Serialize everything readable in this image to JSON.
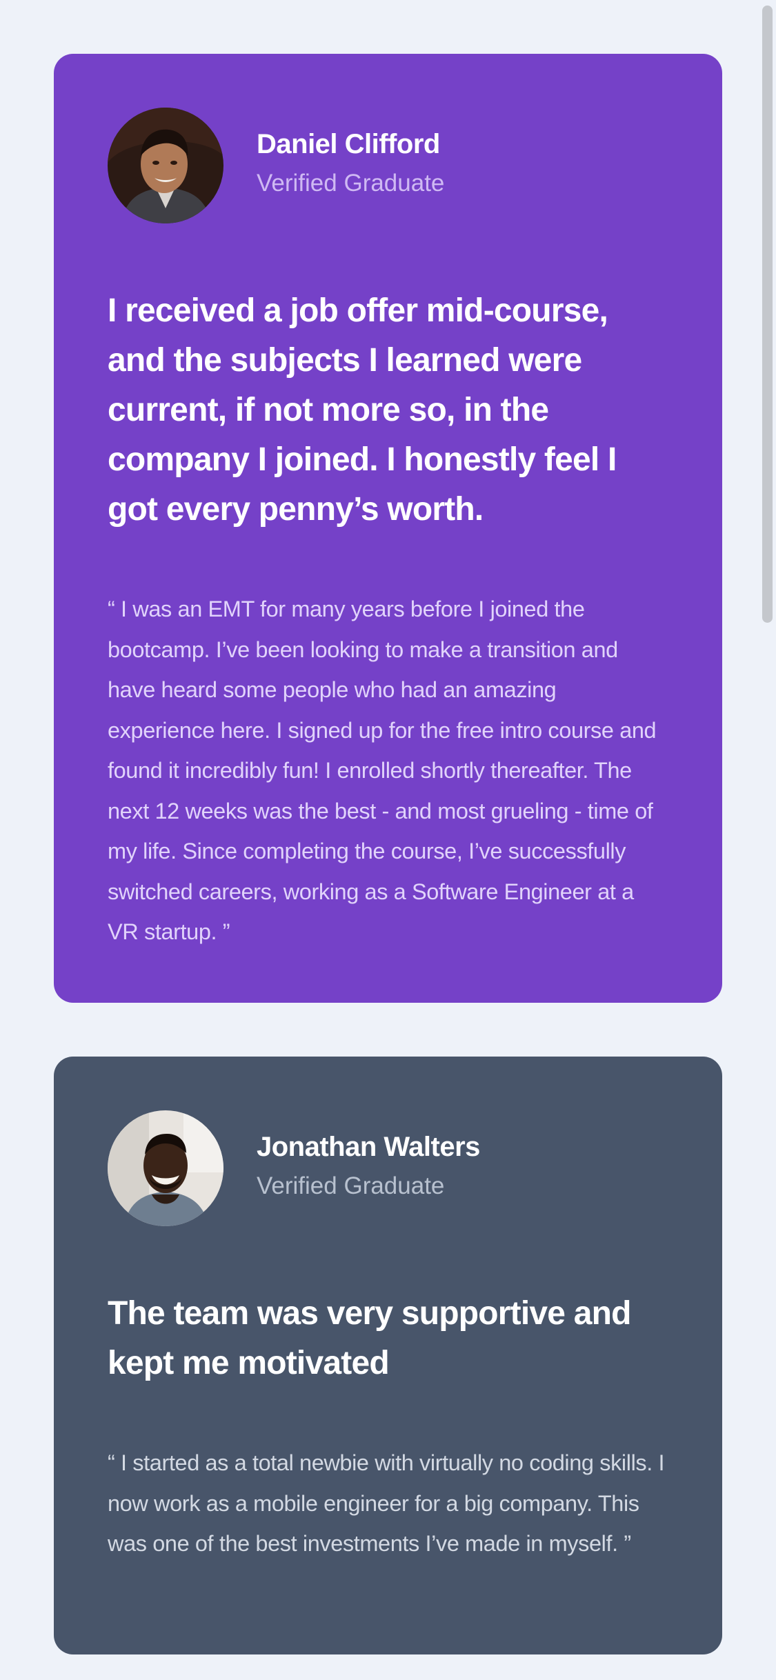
{
  "testimonials": [
    {
      "name": "Daniel Clifford",
      "role": "Verified Graduate",
      "headline": "I received a job offer mid-course, and the subjects I learned were current, if not more so, in the company I joined. I honestly feel I got every penny’s worth.",
      "quote": "“ I was an EMT for many years before I joined the bootcamp. I’ve been looking to make a transition and have heard some people who had an amazing experience here. I signed up for the free intro course and found it incredibly fun! I enrolled shortly thereafter. The next 12 weeks was the best - and most grueling - time of my life. Since completing the course, I’ve successfully switched careers, working as a Software Engineer at a VR startup. ”",
      "card_color": "#7541c8",
      "avatar_icon": "daniel-clifford-photo"
    },
    {
      "name": "Jonathan Walters",
      "role": "Verified Graduate",
      "headline": "The team was very supportive and kept me motivated",
      "quote": "“ I started as a total newbie with virtually no coding skills. I now work as a mobile engineer for a big company. This was one of the best investments I’ve made in myself. ”",
      "card_color": "#48556a",
      "avatar_icon": "jonathan-walters-photo"
    }
  ],
  "page_background": "#eef2f9"
}
